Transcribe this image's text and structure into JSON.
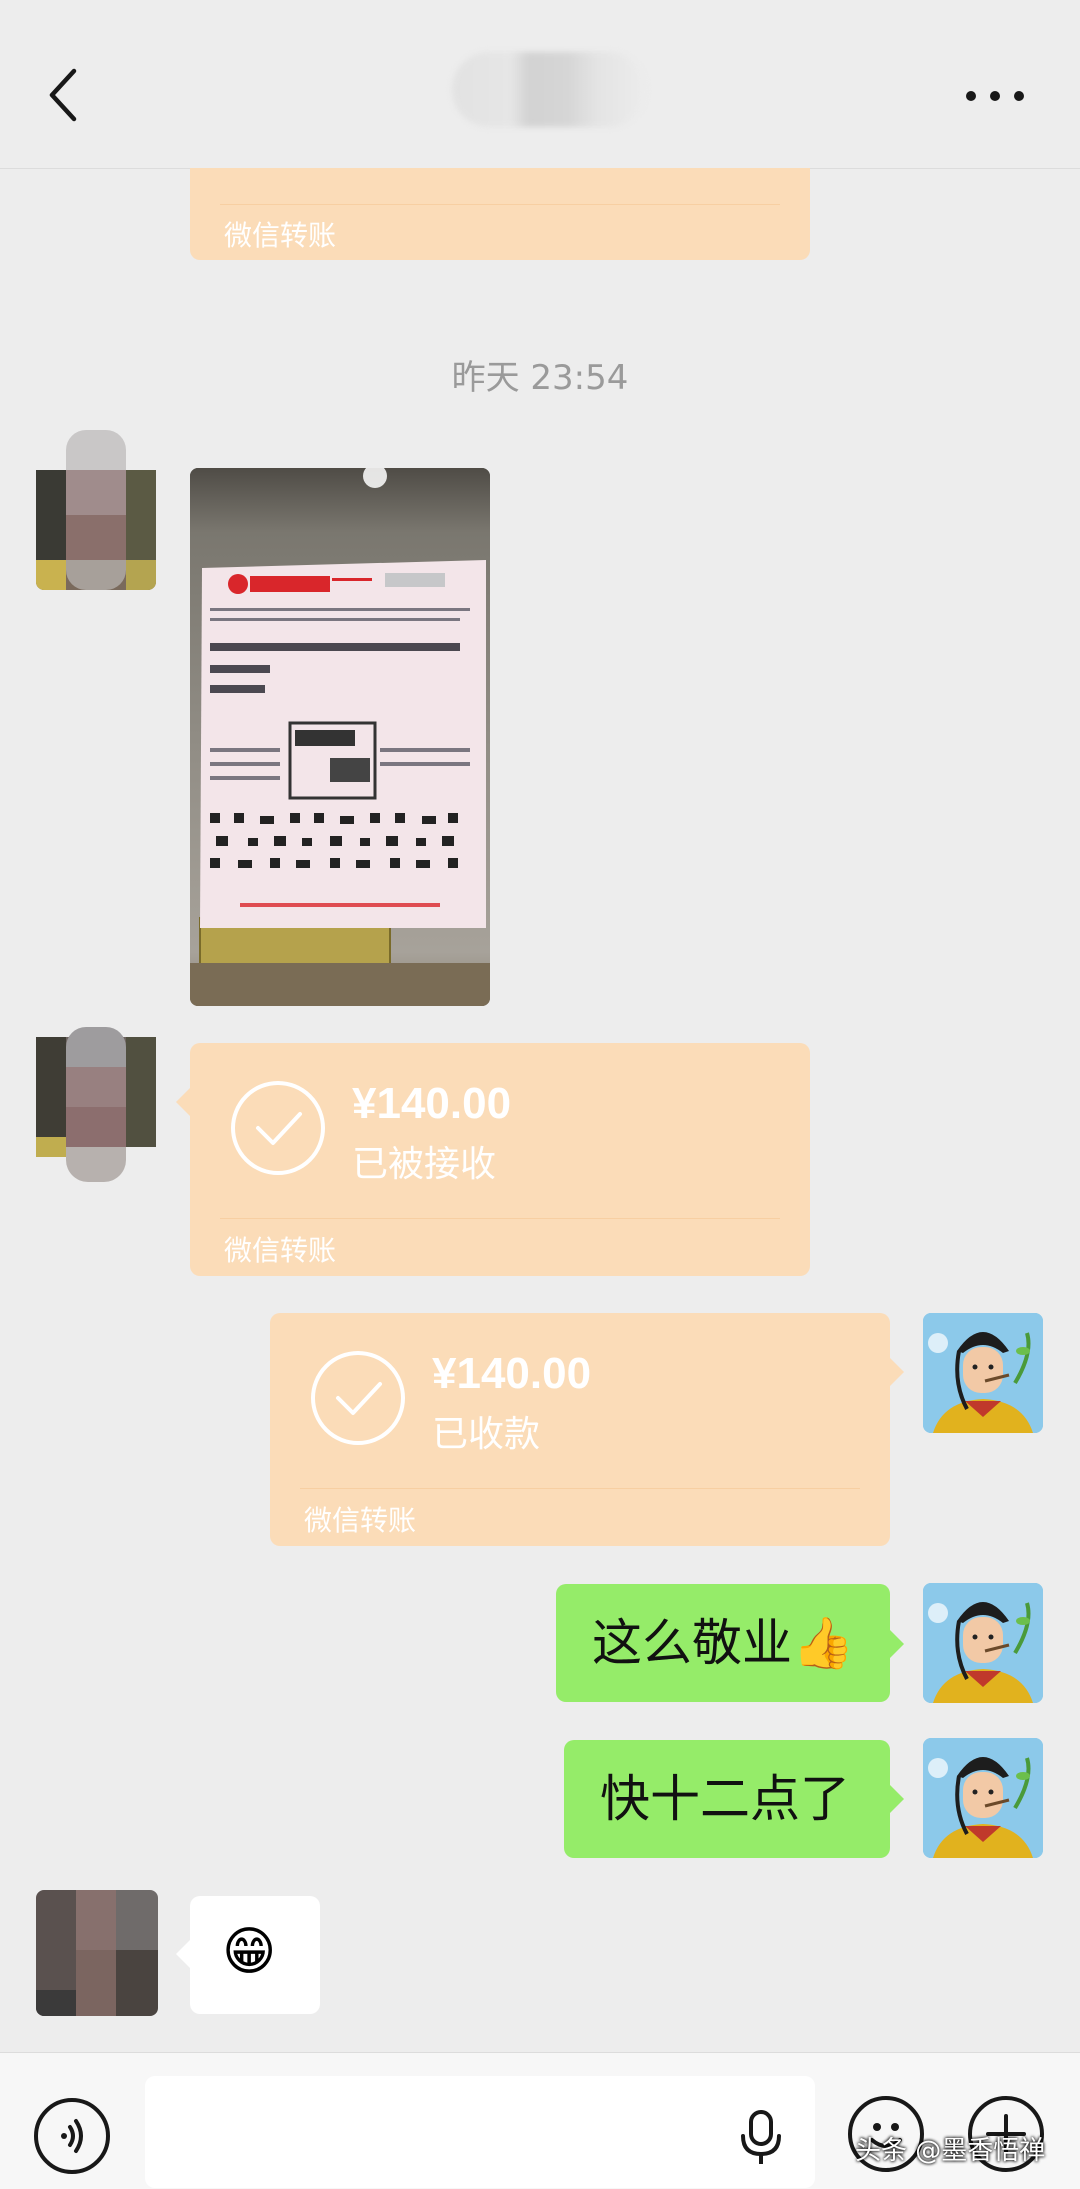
{
  "header": {
    "title": "",
    "back_icon": "chevron-left-icon",
    "more_icon": "more-horizontal-icon"
  },
  "messages": {
    "transfer_top": {
      "footer": "微信转账"
    },
    "timestamp": "昨天 23:54",
    "photo_icon": "lottery-ticket-photo",
    "transfer_received": {
      "amount": "¥140.00",
      "status": "已被接收",
      "footer": "微信转账"
    },
    "transfer_collected": {
      "amount": "¥140.00",
      "status": "已收款",
      "footer": "微信转账"
    },
    "text_1": "这么敬业👍",
    "text_2": "快十二点了",
    "emoji_reply": "😁"
  },
  "input_bar": {
    "voice_icon": "voice-icon",
    "mic_icon": "microphone-icon",
    "emoji_icon": "emoji-icon",
    "plus_icon": "plus-icon",
    "placeholder": ""
  },
  "watermark": "头条 @墨香悟禅",
  "colors": {
    "background": "#ededed",
    "transfer_bg": "#fbdcb8",
    "bubble_green": "#95ec69"
  }
}
